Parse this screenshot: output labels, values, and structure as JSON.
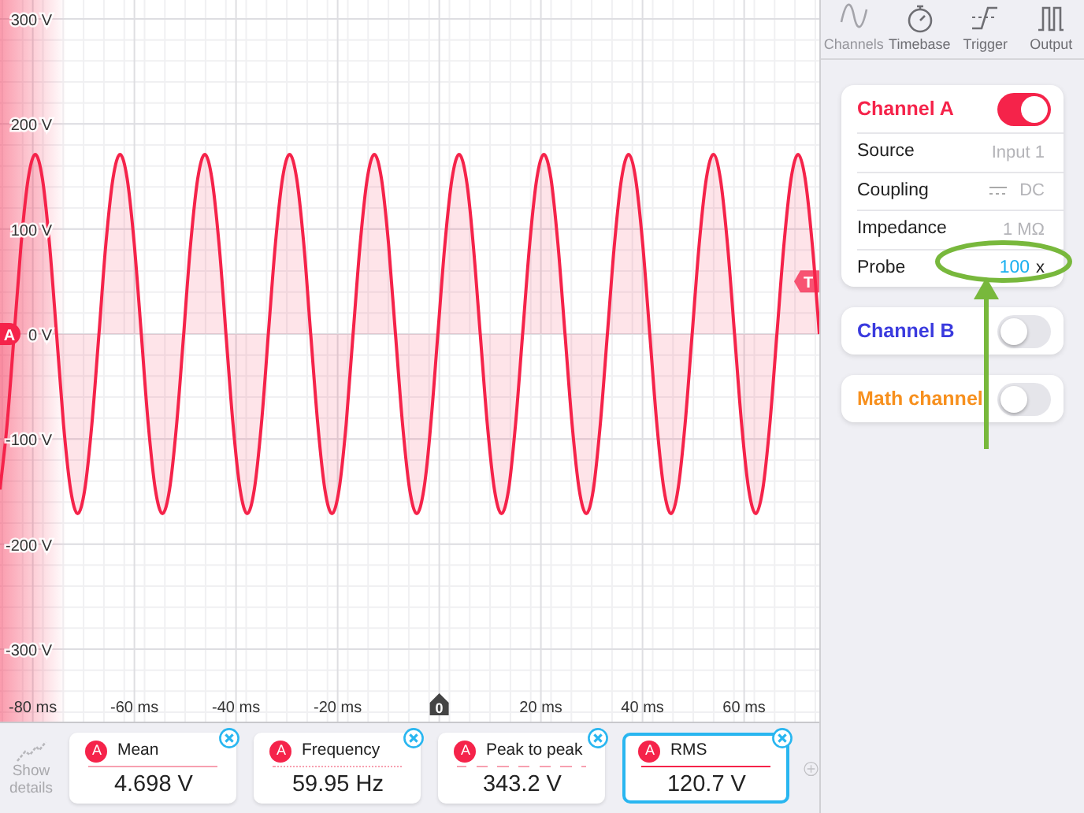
{
  "toolbar": {
    "tabs": [
      {
        "label": "Channels",
        "selected": true
      },
      {
        "label": "Timebase",
        "selected": false
      },
      {
        "label": "Trigger",
        "selected": false
      },
      {
        "label": "Output",
        "selected": false
      }
    ]
  },
  "channels": [
    {
      "name": "Channel A",
      "color": "#f5234a",
      "on": true,
      "settings": [
        {
          "kind": "plain",
          "label": "Source",
          "value": "Input 1"
        },
        {
          "kind": "coupling",
          "label": "Coupling",
          "value": "DC"
        },
        {
          "kind": "plain",
          "label": "Impedance",
          "value": "1 MΩ"
        },
        {
          "kind": "probe",
          "label": "Probe",
          "value": "100",
          "unit": "x"
        }
      ]
    },
    {
      "name": "Channel B",
      "color": "#3a3ade",
      "on": false
    },
    {
      "name": "Math channel",
      "color": "#f7901e",
      "on": false
    }
  ],
  "plot": {
    "channel_marker": "A",
    "trigger_marker": "T",
    "zero_marker": "0",
    "chart_data": {
      "type": "line",
      "xlim": [
        -86.45,
        74.79
      ],
      "ylim": [
        -369,
        318
      ],
      "grid": true,
      "xticks": [
        {
          "value": -80,
          "label": "-80 ms"
        },
        {
          "value": -60,
          "label": "-60 ms"
        },
        {
          "value": -40,
          "label": "-40 ms"
        },
        {
          "value": -20,
          "label": "-20 ms"
        },
        {
          "value": 20,
          "label": "20 ms"
        },
        {
          "value": 40,
          "label": "40 ms"
        },
        {
          "value": 60,
          "label": "60 ms"
        }
      ],
      "yticks": [
        {
          "value": 300,
          "label": "300 V"
        },
        {
          "value": 200,
          "label": "200 V"
        },
        {
          "value": 100,
          "label": "100 V"
        },
        {
          "value": 0,
          "label": "0 V"
        },
        {
          "value": -100,
          "label": "-100 V"
        },
        {
          "value": -200,
          "label": "-200 V"
        },
        {
          "value": -300,
          "label": "-300 V"
        }
      ],
      "x": [
        -86.45,
        -85.06,
        -83.67,
        -82.28,
        -80.89,
        -79.5,
        -78.11,
        -76.72,
        -75.33,
        -73.94,
        -72.55,
        -71.16,
        -69.77,
        -68.38,
        -66.99,
        -65.6,
        -64.21,
        -62.82,
        -61.43,
        -60.04,
        -58.65,
        -57.26,
        -55.87,
        -54.48,
        -53.09,
        -51.7,
        -50.31,
        -48.92,
        -47.53,
        -46.14,
        -44.75,
        -43.36,
        -41.97,
        -40.58,
        -39.19,
        -37.8,
        -36.41,
        -35.02,
        -33.63,
        -32.24,
        -30.85,
        -29.46,
        -28.07,
        -26.68,
        -25.29,
        -23.9,
        -22.51,
        -21.12,
        -19.73,
        -18.34,
        -16.95,
        -15.56,
        -14.17,
        -12.78,
        -11.39,
        -10,
        -8.61,
        -7.22,
        -5.83,
        -4.44,
        -3.05,
        -1.66,
        -0.27,
        1.12,
        2.51,
        3.9,
        5.29,
        6.68,
        8.07,
        9.46,
        10.85,
        12.24,
        13.63,
        15.02,
        16.41,
        17.8,
        19.19,
        20.58,
        21.97,
        23.36,
        24.75,
        26.14,
        27.53,
        28.92,
        30.31,
        31.7,
        33.09,
        34.48,
        35.87,
        37.26,
        38.65,
        40.04,
        41.43,
        42.82,
        44.21,
        45.6,
        46.99,
        48.38,
        49.77,
        51.16,
        52.55,
        53.94,
        55.33,
        56.72,
        58.11,
        59.5,
        60.89,
        62.28,
        63.67,
        65.06,
        66.45,
        67.84,
        69.23,
        70.62,
        72.01,
        73.4,
        74.79
      ],
      "series": [
        {
          "color": "#f5234a",
          "values": [
            -148,
            -86,
            0,
            86,
            148,
            171,
            148,
            86,
            0,
            -86,
            -148,
            -171,
            -148,
            -86,
            0,
            86,
            148,
            171,
            148,
            86,
            0,
            -86,
            -148,
            -171,
            -148,
            -86,
            0,
            86,
            148,
            171,
            148,
            86,
            0,
            -86,
            -148,
            -171,
            -148,
            -86,
            0,
            86,
            148,
            171,
            148,
            86,
            0,
            -86,
            -148,
            -171,
            -148,
            -86,
            0,
            86,
            148,
            171,
            148,
            86,
            0,
            -86,
            -148,
            -171,
            -148,
            -86,
            0,
            86,
            148,
            171,
            148,
            86,
            0,
            -86,
            -148,
            -171,
            -148,
            -86,
            0,
            86,
            148,
            171,
            148,
            86,
            0,
            -86,
            -148,
            -171,
            -148,
            -86,
            0,
            86,
            148,
            171,
            148,
            86,
            0,
            -86,
            -148,
            -171,
            -148,
            -86,
            0,
            86,
            148,
            171,
            148,
            86,
            0,
            -86,
            -148,
            -171,
            -148,
            -86,
            0,
            86,
            148,
            171,
            148,
            86,
            0
          ]
        }
      ]
    }
  },
  "bottom_bar": {
    "show_details": "Show details",
    "measurements": [
      {
        "channel": "A",
        "label": "Mean",
        "value": "4.698 V",
        "kind": "solid",
        "selected": false
      },
      {
        "channel": "A",
        "label": "Frequency",
        "value": "59.95 Hz",
        "kind": "dotted",
        "selected": false
      },
      {
        "channel": "A",
        "label": "Peak to peak",
        "value": "343.2 V",
        "kind": "dashed",
        "selected": false
      },
      {
        "channel": "A",
        "label": "RMS",
        "value": "120.7 V",
        "kind": "solid",
        "selected": true
      }
    ]
  }
}
